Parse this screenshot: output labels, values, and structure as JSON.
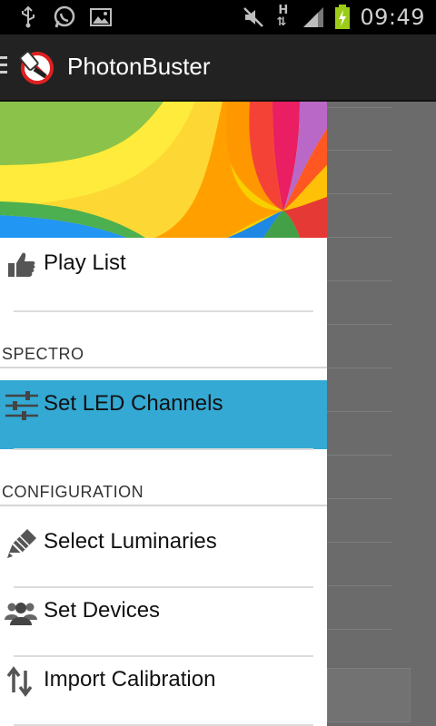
{
  "status_bar": {
    "time": "09:49",
    "icons": [
      "usb-icon",
      "whatsapp-icon",
      "image-icon",
      "mute-icon",
      "hspa-data-icon",
      "signal-icon",
      "battery-charging-icon"
    ],
    "network_label": "H"
  },
  "action_bar": {
    "title": "PhotonBuster",
    "brand_color": "#e02020"
  },
  "drawer": {
    "items": [
      {
        "label": "Play List",
        "icon": "thumbs-up-icon"
      }
    ],
    "sections": [
      {
        "header": "SPECTRO",
        "items": [
          {
            "label": "Set LED Channels",
            "icon": "sliders-icon",
            "selected": true
          }
        ]
      },
      {
        "header": "CONFIGURATION",
        "items": [
          {
            "label": "Select Luminaries",
            "icon": "pencil-icon"
          },
          {
            "label": "Set Devices",
            "icon": "users-icon"
          },
          {
            "label": "Import Calibration",
            "icon": "transfer-icon"
          }
        ]
      }
    ],
    "selected_color": "#33a9d4"
  }
}
